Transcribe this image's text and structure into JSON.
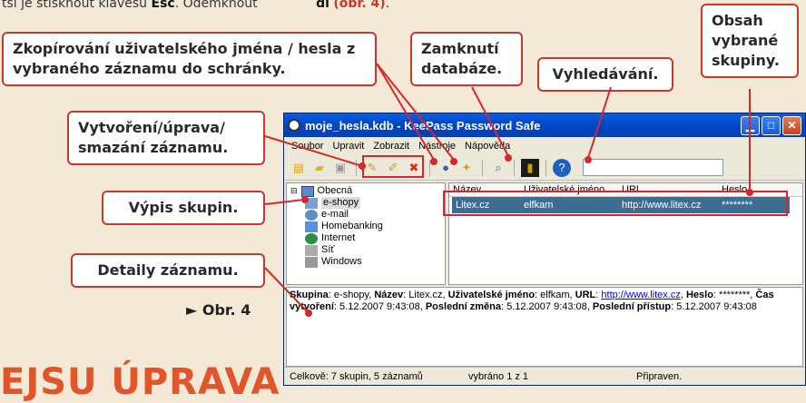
{
  "intro_text": {
    "pre": "tší je stisknout klávesu ",
    "esc": "Esc",
    "mid": ". Odemknout",
    "end_bold": "dí",
    "obr_ref": "(obr. 4)",
    "after": "."
  },
  "callouts": {
    "copy": "Zkopírování uživatelského jména / hesla z vybraného záznamu do schránky.",
    "lock": "Zamknutí databáze.",
    "search": "Vyhledávání.",
    "group_content": "Obsah vybrané skupiny.",
    "create_edit": "Vytvoření/úprava/ smazání záznamu.",
    "group_list": "Výpis skupin.",
    "details": "Detaily záznamu."
  },
  "figure_label": "► Obr. 4",
  "heading_partial": "EJSU ÚPRAVA",
  "window": {
    "title": "moje_hesla.kdb - KeePass Password Safe",
    "menu": [
      "Soubor",
      "Upravit",
      "Zobrazit",
      "Nástroje",
      "Nápověda"
    ],
    "tree": {
      "root": "Obecná",
      "children": [
        "e-shopy",
        "e-mail",
        "Homebanking",
        "Internet",
        "Síť",
        "Windows"
      ]
    },
    "columns": [
      "Název",
      "Uživatelské jméno",
      "URL",
      "Heslo"
    ],
    "row": {
      "name": "Litex.cz",
      "user": "elfkam",
      "url": "http://www.litex.cz",
      "password": "********"
    },
    "details": {
      "l1": "Skupina",
      "v1": ": e-shopy, ",
      "l2": "Název",
      "v2": ": Litex.cz, ",
      "l3": "Uživatelské jméno",
      "v3": ": elfkam, ",
      "l4": "URL",
      "v4": ": ",
      "url": "http://www.litex.cz",
      "v4b": ", ",
      "l5": "Heslo",
      "v5": ": ********, ",
      "l6": "Čas vytvoření",
      "v6": ": 5.12.2007 9:43:08, ",
      "l7": "Poslední změna",
      "v7": ": 5.12.2007 9:43:08, ",
      "l8": "Poslední přístup",
      "v8": ": 5.12.2007 9:43:08"
    },
    "status": {
      "total": "Celkově: 7 skupin, 5 záznamů",
      "selected": "vybráno 1 z 1",
      "ready": "Připraven."
    }
  },
  "colors": {
    "accent": "#c8392a",
    "selection": "#3d6c94",
    "title_blue": "#0a5ee0"
  }
}
